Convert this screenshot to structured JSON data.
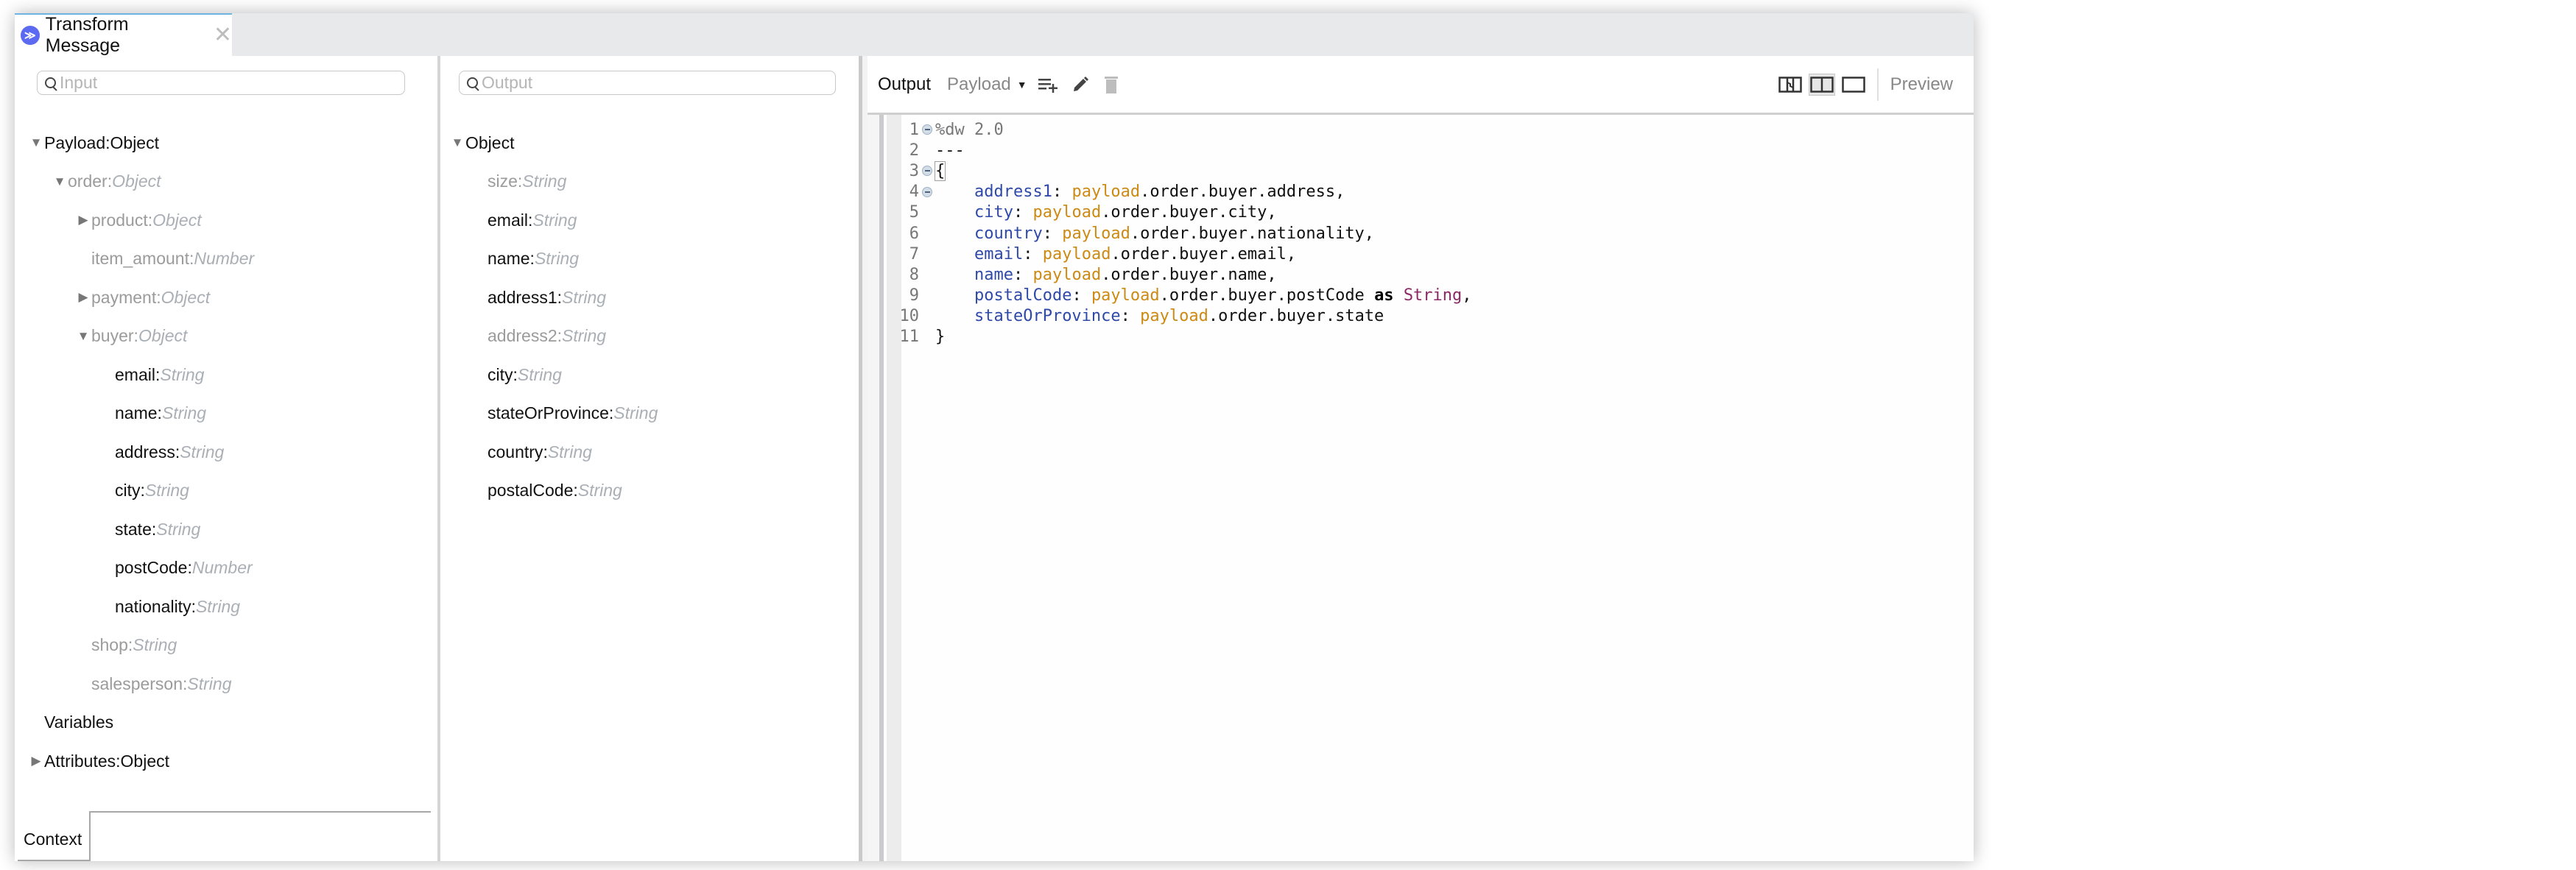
{
  "window": {
    "tab": {
      "title": "Transform Message",
      "icon": "dataweave-logo-icon",
      "close_symbol": "✕"
    },
    "accent_color": "#5b6af0"
  },
  "input_panel": {
    "search": {
      "placeholder": "Input",
      "value": ""
    },
    "tree": [
      {
        "label": "Payload",
        "type": "Object",
        "depth": 0,
        "toggle": "expanded",
        "dim": false,
        "type_italic": false
      },
      {
        "label": "order",
        "type": "Object",
        "depth": 1,
        "toggle": "expanded",
        "dim": true,
        "type_italic": true
      },
      {
        "label": "product",
        "type": "Object",
        "depth": 2,
        "toggle": "collapsed",
        "dim": true,
        "type_italic": true
      },
      {
        "label": "item_amount",
        "type": "Number",
        "depth": 2,
        "toggle": "none",
        "dim": true,
        "type_italic": true
      },
      {
        "label": "payment",
        "type": "Object",
        "depth": 2,
        "toggle": "collapsed",
        "dim": true,
        "type_italic": true
      },
      {
        "label": "buyer",
        "type": "Object",
        "depth": 2,
        "toggle": "expanded",
        "dim": true,
        "type_italic": true
      },
      {
        "label": "email",
        "type": "String",
        "depth": 3,
        "toggle": "none",
        "dim": false,
        "type_italic": true
      },
      {
        "label": "name",
        "type": "String",
        "depth": 3,
        "toggle": "none",
        "dim": false,
        "type_italic": true
      },
      {
        "label": "address",
        "type": "String",
        "depth": 3,
        "toggle": "none",
        "dim": false,
        "type_italic": true
      },
      {
        "label": "city",
        "type": "String",
        "depth": 3,
        "toggle": "none",
        "dim": false,
        "type_italic": true
      },
      {
        "label": "state",
        "type": "String",
        "depth": 3,
        "toggle": "none",
        "dim": false,
        "type_italic": true
      },
      {
        "label": "postCode",
        "type": "Number",
        "depth": 3,
        "toggle": "none",
        "dim": false,
        "type_italic": true
      },
      {
        "label": "nationality",
        "type": "String",
        "depth": 3,
        "toggle": "none",
        "dim": false,
        "type_italic": true
      },
      {
        "label": "shop",
        "type": "String",
        "depth": 2,
        "toggle": "none",
        "dim": true,
        "type_italic": true
      },
      {
        "label": "salesperson",
        "type": "String",
        "depth": 2,
        "toggle": "none",
        "dim": true,
        "type_italic": true
      },
      {
        "label": "Variables",
        "type": null,
        "depth": 0,
        "toggle": "none",
        "dim": false,
        "type_italic": false
      },
      {
        "label": "Attributes",
        "type": "Object",
        "depth": 0,
        "toggle": "collapsed",
        "dim": false,
        "type_italic": false
      }
    ],
    "context_label": "Context"
  },
  "output_panel": {
    "search": {
      "placeholder": "Output",
      "value": ""
    },
    "tree": [
      {
        "label": "Object",
        "type": null,
        "depth": 0,
        "toggle": "expanded",
        "dim": false
      },
      {
        "label": "size",
        "type": "String",
        "depth": 1,
        "toggle": "none",
        "dim": true
      },
      {
        "label": "email",
        "type": "String",
        "depth": 1,
        "toggle": "none",
        "dim": false
      },
      {
        "label": "name",
        "type": "String",
        "depth": 1,
        "toggle": "none",
        "dim": false
      },
      {
        "label": "address1",
        "type": "String",
        "depth": 1,
        "toggle": "none",
        "dim": false
      },
      {
        "label": "address2",
        "type": "String",
        "depth": 1,
        "toggle": "none",
        "dim": true
      },
      {
        "label": "city",
        "type": "String",
        "depth": 1,
        "toggle": "none",
        "dim": false
      },
      {
        "label": "stateOrProvince",
        "type": "String",
        "depth": 1,
        "toggle": "none",
        "dim": false
      },
      {
        "label": "country",
        "type": "String",
        "depth": 1,
        "toggle": "none",
        "dim": false
      },
      {
        "label": "postalCode",
        "type": "String",
        "depth": 1,
        "toggle": "none",
        "dim": false
      }
    ]
  },
  "editor": {
    "toolbar": {
      "output_label": "Output",
      "target_select": "Payload",
      "add_icon": "add-list-icon",
      "edit_icon": "pencil-icon",
      "delete_icon": "trash-icon",
      "layout_buttons": [
        {
          "name": "graphics-and-script-layout",
          "active": false
        },
        {
          "name": "split-layout",
          "active": true
        },
        {
          "name": "script-only-layout",
          "active": false
        }
      ],
      "preview_label": "Preview"
    },
    "colors": {
      "key": "#2f49a8",
      "payload": "#cc8a14",
      "type": "#8a2a62",
      "directive": "#777777"
    },
    "lines": [
      {
        "n": "1",
        "fold": true,
        "tokens": [
          {
            "t": "%dw 2.0",
            "c": "dir"
          }
        ]
      },
      {
        "n": "2",
        "fold": false,
        "tokens": [
          {
            "t": "---",
            "c": "plain"
          }
        ]
      },
      {
        "n": "3",
        "fold": true,
        "tokens": [
          {
            "t": "{",
            "c": "brace"
          }
        ]
      },
      {
        "n": "4",
        "fold": true,
        "tokens": [
          {
            "t": "    ",
            "c": "plain"
          },
          {
            "t": "address1",
            "c": "key"
          },
          {
            "t": ": ",
            "c": "plain"
          },
          {
            "t": "payload",
            "c": "payload"
          },
          {
            "t": ".order.buyer.address,",
            "c": "plain"
          }
        ]
      },
      {
        "n": "5",
        "fold": false,
        "tokens": [
          {
            "t": "    ",
            "c": "plain"
          },
          {
            "t": "city",
            "c": "key"
          },
          {
            "t": ": ",
            "c": "plain"
          },
          {
            "t": "payload",
            "c": "payload"
          },
          {
            "t": ".order.buyer.city,",
            "c": "plain"
          }
        ]
      },
      {
        "n": "6",
        "fold": false,
        "tokens": [
          {
            "t": "    ",
            "c": "plain"
          },
          {
            "t": "country",
            "c": "key"
          },
          {
            "t": ": ",
            "c": "plain"
          },
          {
            "t": "payload",
            "c": "payload"
          },
          {
            "t": ".order.buyer.nationality,",
            "c": "plain"
          }
        ]
      },
      {
        "n": "7",
        "fold": false,
        "tokens": [
          {
            "t": "    ",
            "c": "plain"
          },
          {
            "t": "email",
            "c": "key"
          },
          {
            "t": ": ",
            "c": "plain"
          },
          {
            "t": "payload",
            "c": "payload"
          },
          {
            "t": ".order.buyer.email,",
            "c": "plain"
          }
        ]
      },
      {
        "n": "8",
        "fold": false,
        "tokens": [
          {
            "t": "    ",
            "c": "plain"
          },
          {
            "t": "name",
            "c": "key"
          },
          {
            "t": ": ",
            "c": "plain"
          },
          {
            "t": "payload",
            "c": "payload"
          },
          {
            "t": ".order.buyer.name,",
            "c": "plain"
          }
        ]
      },
      {
        "n": "9",
        "fold": false,
        "tokens": [
          {
            "t": "    ",
            "c": "plain"
          },
          {
            "t": "postalCode",
            "c": "key"
          },
          {
            "t": ": ",
            "c": "plain"
          },
          {
            "t": "payload",
            "c": "payload"
          },
          {
            "t": ".order.buyer.postCode ",
            "c": "plain"
          },
          {
            "t": "as",
            "c": "kw"
          },
          {
            "t": " ",
            "c": "plain"
          },
          {
            "t": "String",
            "c": "type"
          },
          {
            "t": ",",
            "c": "plain"
          }
        ]
      },
      {
        "n": "10",
        "fold": false,
        "tokens": [
          {
            "t": "    ",
            "c": "plain"
          },
          {
            "t": "stateOrProvince",
            "c": "key"
          },
          {
            "t": ": ",
            "c": "plain"
          },
          {
            "t": "payload",
            "c": "payload"
          },
          {
            "t": ".order.buyer.state",
            "c": "plain"
          }
        ]
      },
      {
        "n": "11",
        "fold": false,
        "tokens": [
          {
            "t": "}",
            "c": "plain"
          }
        ]
      }
    ]
  }
}
